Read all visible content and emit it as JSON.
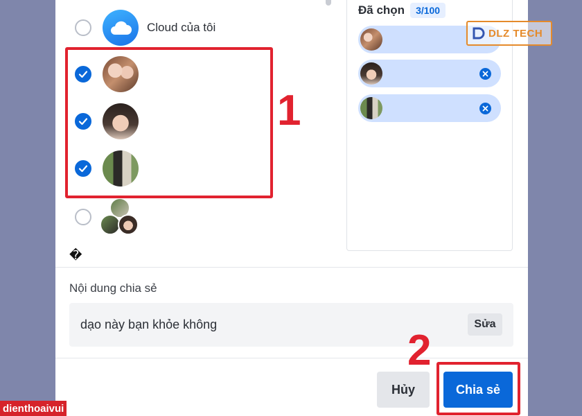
{
  "contacts": [
    {
      "label": "Cloud của tôi",
      "checked": false,
      "avatar": "cloud-icon"
    },
    {
      "label": "",
      "checked": true,
      "avatar": "photo"
    },
    {
      "label": "",
      "checked": true,
      "avatar": "photo"
    },
    {
      "label": "",
      "checked": true,
      "avatar": "photo"
    },
    {
      "label": "",
      "checked": false,
      "avatar": "group-photo"
    }
  ],
  "missing_glyph": "�",
  "selected_panel": {
    "title": "Đã chọn",
    "count": "3/100",
    "chips": 3
  },
  "share_content": {
    "label": "Nội dung chia sẻ",
    "message": "dạo này bạn khỏe không",
    "edit_label": "Sửa"
  },
  "buttons": {
    "cancel": "Hủy",
    "share": "Chia sẻ"
  },
  "annotations": {
    "step1": "1",
    "step2": "2"
  },
  "watermarks": {
    "logo": "DLZ TECH",
    "brand": "dienthoaivui"
  },
  "colors": {
    "accent": "#0a68d9",
    "chip_bg": "#cfe0ff",
    "annotation": "#e1222f",
    "background": "#7f86ab"
  }
}
